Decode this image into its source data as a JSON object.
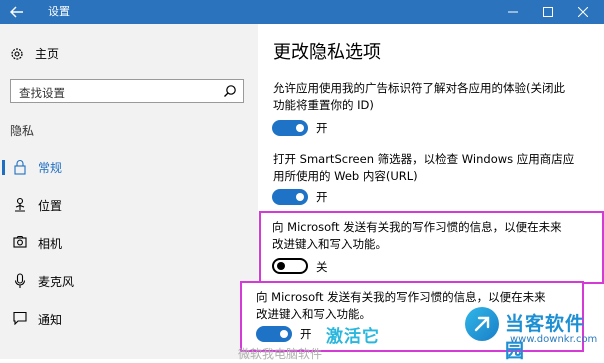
{
  "window": {
    "title": "设置"
  },
  "sidebar": {
    "home_label": "主页",
    "search_placeholder": "查找设置",
    "section_label": "隐私",
    "items": [
      {
        "label": "常规",
        "icon": "lock-icon",
        "active": true
      },
      {
        "label": "位置",
        "icon": "location-person-icon",
        "active": false
      },
      {
        "label": "相机",
        "icon": "camera-icon",
        "active": false
      },
      {
        "label": "麦克风",
        "icon": "microphone-icon",
        "active": false
      },
      {
        "label": "通知",
        "icon": "chat-bubble-icon",
        "active": false
      }
    ]
  },
  "main": {
    "title": "更改隐私选项",
    "settings": [
      {
        "text_line1": "允许应用使用我的广告标识符了解对各应用的体验(关闭此",
        "text_line2": "功能将重置你的 ID)",
        "state": "on",
        "state_label": "开"
      },
      {
        "text_line1": "打开 SmartScreen 筛选器，以检查 Windows 应用商店应",
        "text_line2": "用所使用的 Web 内容(URL)",
        "state": "on",
        "state_label": "开"
      },
      {
        "text_line1": "向 Microsoft 发送有关我的写作习惯的信息，以便在未来",
        "text_line2": "改进键入和写入功能。",
        "state": "off",
        "state_label": "关"
      }
    ]
  },
  "overlay": {
    "text_line1": "向 Microsoft 发送有关我的写作习惯的信息，以便在未来",
    "text_line2": "改进键入和写入功能。",
    "state": "on",
    "state_label": "开",
    "activate_text": "激活它"
  },
  "branding": {
    "logo_text": "当客软件园",
    "logo_url": "www.downkr.com",
    "watermark": "微软我电脑软件"
  },
  "colors": {
    "titlebar": "#2b74bd",
    "accent": "#1f73c6",
    "highlight_border": "#d43ad6",
    "activate_text": "#29b7de"
  }
}
